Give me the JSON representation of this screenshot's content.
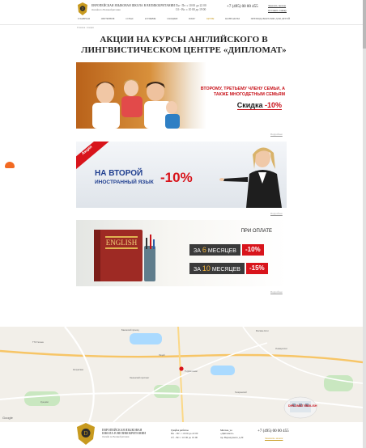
{
  "header": {
    "brand_line1": "Европейская языковая школа в Великобритании",
    "brand_line2": "Онлайн по Великобритании",
    "hours_line1": "Пн - Пт: с 10 00 до 22 00",
    "hours_line2": "Сб - Вс: с 10 00 до 19 00",
    "phone": "+7 (495) 00 00 455",
    "link1": "Заказать звонок",
    "link2": "Оставить заявку"
  },
  "nav": {
    "items": [
      {
        "label": "Главная",
        "active": false
      },
      {
        "label": "Обучение",
        "active": false
      },
      {
        "label": "О нас",
        "active": false
      },
      {
        "label": "Отзывы",
        "active": false
      },
      {
        "label": "Скидки",
        "active": false
      },
      {
        "label": "Блог",
        "active": false
      },
      {
        "label": "Цены",
        "active": true
      },
      {
        "label": "Контакты",
        "active": false
      },
      {
        "label": "Преподавателям для детей",
        "active": false
      }
    ]
  },
  "breadcrumb": "Главная / Акции",
  "page_title": "АКЦИИ НА КУРСЫ АНГЛИЙСКОГО В ЛИНГВИСТИЧЕСКОМ ЦЕНТРЕ «ДИПЛОМАТ»",
  "more_label": "Подробнее",
  "banner1": {
    "text": "Второму, третьему члену семьи, а также многодетным семьям",
    "discount_word": "Скидка",
    "discount_value": "-10%"
  },
  "banner2": {
    "ribbon": "Акция",
    "line1": "НА ВТОРОЙ",
    "line2": "ИНОСТРАННЫЙ ЯЗЫК",
    "discount": "-10%"
  },
  "banner3": {
    "book_title": "ENGLISH",
    "heading": "При оплате",
    "row1_pre": "ЗА",
    "row1_num": "6",
    "row1_post": "МЕСЯЦЕВ",
    "row1_discount": "-10%",
    "row2_pre": "ЗА",
    "row2_num": "10",
    "row2_post": "МЕСЯЦЕВ",
    "row2_discount": "-15%"
  },
  "map": {
    "labels": [
      "ТТК Гасана",
      "Бакинский проезд",
      "Лицей",
      "ТЦ Дипломат",
      "Ленинский проспект",
      "Калужская",
      "Гагаринский",
      "Университет",
      "Кунцево",
      "Москва-Сити"
    ],
    "badge": "DIPLOMAT ENGLISH",
    "attribution": "Google"
  },
  "footer": {
    "brand_line1": "Европейская языковая",
    "brand_line2": "школа в Великобритании",
    "brand_small": "Онлайн по Великобритании",
    "col1_head": "График работы",
    "col1_line1": "Пн - Пт: с 10 00 до 22 00",
    "col1_line2": "Сб - Вс: с 10 00 до 19 00",
    "col2_head": "Москва, ул.",
    "col2_line1": "«Дипломат»",
    "col2_line2": "пр. Вернадского д.29",
    "phone": "+7 (495) 00 00 455",
    "link": "Заказать звонок"
  }
}
